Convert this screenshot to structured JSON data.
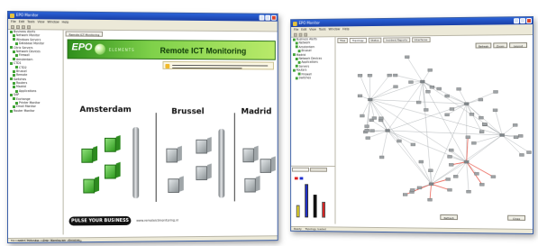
{
  "left_window": {
    "title": "EPO Monitor",
    "menu": [
      "File",
      "Edit",
      "Tools",
      "View",
      "Window",
      "Help"
    ],
    "tree": [
      "Business Alerts",
      "Network Monitor",
      "Windows Servers",
      "Database Monitor",
      "Citrix Servers",
      "Network Devices",
      "Firewall",
      "Amsterdam",
      "CTD1",
      "CTD2",
      "Brussel",
      "Remote",
      "Switches",
      "Routers",
      "Madrid",
      "Applications",
      "SAP",
      "Exchange",
      "Printer Monitor",
      "Email Monitor",
      "Router Monitor"
    ],
    "tab": "Remote ICT Monitoring",
    "logo_text": "EPO",
    "logo_sub": "ELEMENTS",
    "banner_title": "Remote ICT Monitoring",
    "cities": [
      "Amsterdam",
      "Brussel",
      "Madrid"
    ],
    "footer_slogan": "PULSE YOUR BUSINESS",
    "footer_url": "www.remoteictmonitoring.nl",
    "status": [
      "Microsoft ICT Monitor",
      "Data Warehouse",
      "Services"
    ],
    "bottom_bar": [
      "Start",
      "Business Alerts",
      "Remote ICT Monitoring"
    ]
  },
  "right_window": {
    "title": "EPO Monitor",
    "menu": [
      "File",
      "Edit",
      "View",
      "Tools",
      "Window",
      "Help"
    ],
    "tabs": [
      "Tree",
      "Topology",
      "Status",
      "Incident Reports",
      "Interfaces"
    ],
    "tree": [
      "Business Alerts",
      "Network",
      "Amsterdam",
      "Brussel",
      "Madrid",
      "Network Devices",
      "Applications",
      "Servers",
      "Routers",
      "Firewall",
      "Switches"
    ],
    "toolbar_buttons": [
      "Refresh",
      "Zoom",
      "Layout"
    ],
    "bottom_buttons": [
      "Refresh",
      "Close"
    ],
    "status": [
      "Ready",
      "Topology loaded"
    ],
    "chart_legend": [
      "Red",
      "Blue",
      "Black",
      "Yellow"
    ],
    "colors": {
      "node": "#9ea3a6",
      "link": "#9fa4a8",
      "alert_link": "#e84a3c",
      "accent": "#2a62d8"
    }
  }
}
